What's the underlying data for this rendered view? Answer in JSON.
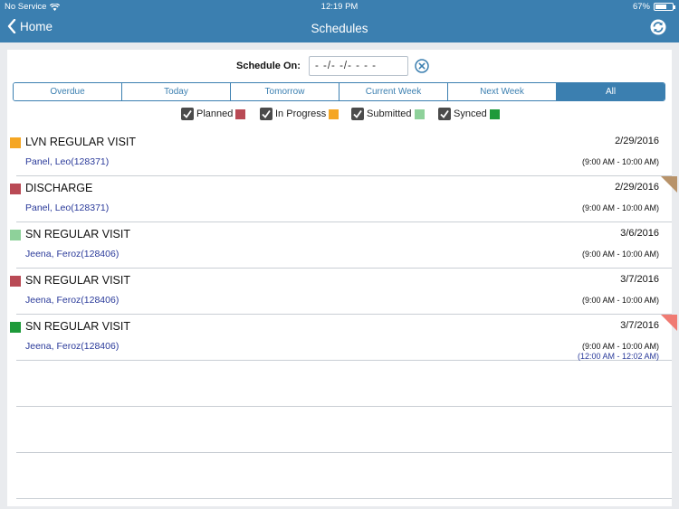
{
  "status_bar": {
    "carrier": "No Service",
    "time": "12:19 PM",
    "battery": "67%",
    "battery_level": 0.67
  },
  "nav": {
    "back_label": "Home",
    "title": "Schedules"
  },
  "filter": {
    "label": "Schedule On:",
    "date_value": "- -/- -/- - - -"
  },
  "tabs": [
    {
      "label": "Overdue",
      "active": false
    },
    {
      "label": "Today",
      "active": false
    },
    {
      "label": "Tomorrow",
      "active": false
    },
    {
      "label": "Current Week",
      "active": false
    },
    {
      "label": "Next Week",
      "active": false
    },
    {
      "label": "All",
      "active": true
    }
  ],
  "legend": [
    {
      "label": "Planned",
      "color": "#b94a55",
      "checked": true
    },
    {
      "label": "In Progress",
      "color": "#f5a623",
      "checked": true
    },
    {
      "label": "Submitted",
      "color": "#8ed19a",
      "checked": true
    },
    {
      "label": "Synced",
      "color": "#1e9a3a",
      "checked": true
    }
  ],
  "schedules": [
    {
      "visit": "LVN REGULAR VISIT",
      "date": "2/29/2016",
      "patient": "Panel, Leo(128371)",
      "time": "(9:00 AM - 10:00 AM)",
      "time2": "",
      "status_color": "#f5a623",
      "corner_color": ""
    },
    {
      "visit": "DISCHARGE",
      "date": "2/29/2016",
      "patient": "Panel, Leo(128371)",
      "time": "(9:00 AM - 10:00 AM)",
      "time2": "",
      "status_color": "#b94a55",
      "corner_color": "#b8936a"
    },
    {
      "visit": "SN REGULAR VISIT",
      "date": "3/6/2016",
      "patient": "Jeena, Feroz(128406)",
      "time": "(9:00 AM - 10:00 AM)",
      "time2": "",
      "status_color": "#8ed19a",
      "corner_color": ""
    },
    {
      "visit": "SN REGULAR VISIT",
      "date": "3/7/2016",
      "patient": "Jeena, Feroz(128406)",
      "time": "(9:00 AM - 10:00 AM)",
      "time2": "",
      "status_color": "#b94a55",
      "corner_color": ""
    },
    {
      "visit": "SN REGULAR VISIT",
      "date": "3/7/2016",
      "patient": "Jeena, Feroz(128406)",
      "time": "(9:00 AM - 10:00 AM)",
      "time2": "(12:00 AM - 12:02 AM)",
      "status_color": "#1e9a3a",
      "corner_color": "#f07b73"
    }
  ],
  "empty_rows": 3,
  "colors": {
    "accent": "#3b7fb0"
  }
}
